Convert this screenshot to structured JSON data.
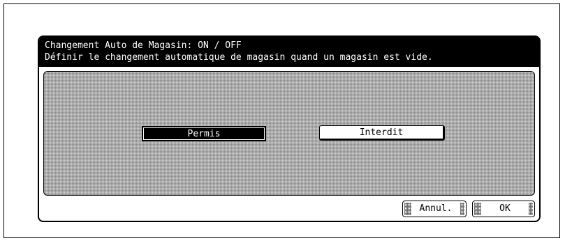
{
  "dialog": {
    "title_line1": "Changement Auto de Magasin: ON / OFF",
    "title_line2": "Définir le changement automatique de magasin quand un magasin est vide."
  },
  "options": {
    "permis_label": "Permis",
    "interdit_label": "Interdit",
    "selected": "Permis"
  },
  "footer": {
    "cancel_label": "Annul.",
    "ok_label": "OK"
  }
}
